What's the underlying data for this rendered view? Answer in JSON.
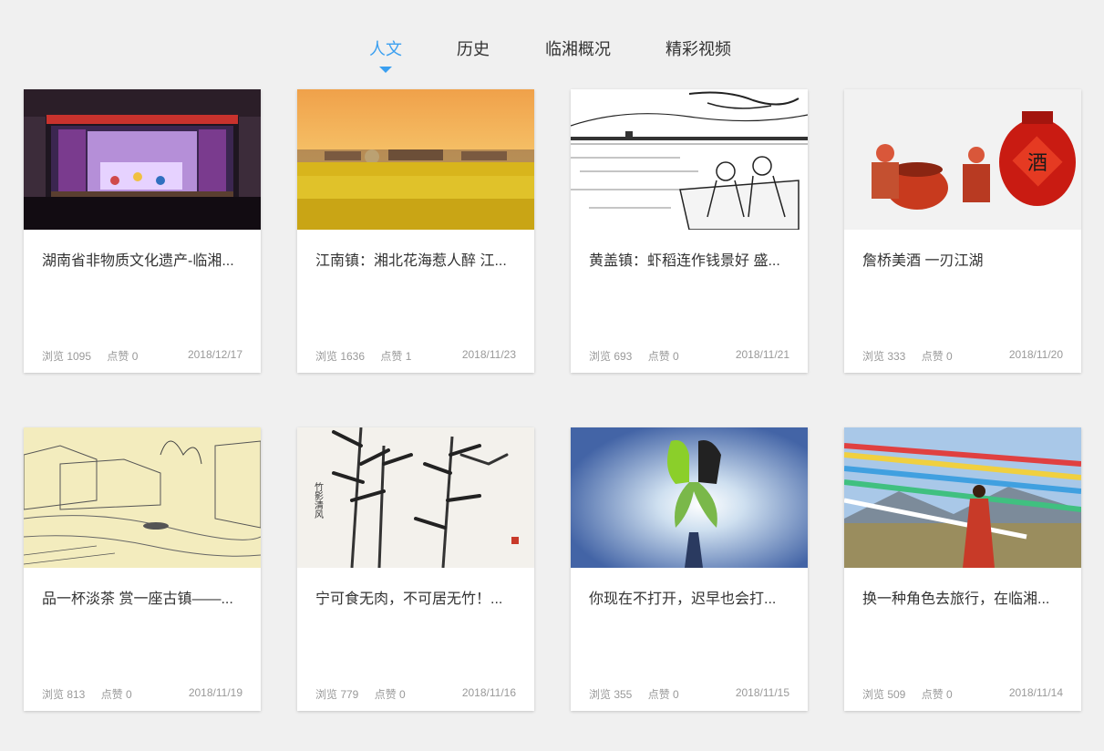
{
  "tabs": [
    {
      "label": "人文",
      "active": true
    },
    {
      "label": "历史",
      "active": false
    },
    {
      "label": "临湘概况",
      "active": false
    },
    {
      "label": "精彩视频",
      "active": false
    }
  ],
  "accent_color": "#3a9ff0",
  "cards": [
    {
      "title": "湖南省非物质文化遗产-临湘...",
      "views": "浏览 1095",
      "likes": "点赞 0",
      "date": "2018/12/17",
      "image": "stage-performance-photo"
    },
    {
      "title": "江南镇：湘北花海惹人醉 江...",
      "views": "浏览 1636",
      "likes": "点赞 1",
      "date": "2018/11/23",
      "image": "rapeseed-field-sunset-photo"
    },
    {
      "title": "黄盖镇：虾稻连作钱景好 盛...",
      "views": "浏览 693",
      "likes": "点赞 0",
      "date": "2018/11/21",
      "image": "ink-boat-illustration"
    },
    {
      "title": "詹桥美酒 一刃江湖",
      "views": "浏览 333",
      "likes": "点赞 0",
      "date": "2018/11/20",
      "image": "wine-jar-illustration"
    },
    {
      "title": "品一杯淡茶 赏一座古镇——...",
      "views": "浏览 813",
      "likes": "点赞 0",
      "date": "2018/11/19",
      "image": "old-town-sketch"
    },
    {
      "title": "宁可食无肉，不可居无竹！...",
      "views": "浏览 779",
      "likes": "点赞 0",
      "date": "2018/11/16",
      "image": "bamboo-ink-painting"
    },
    {
      "title": "你现在不打开，迟早也会打...",
      "views": "浏览 355",
      "likes": "点赞 0",
      "date": "2018/11/15",
      "image": "leaf-silhouette-photo"
    },
    {
      "title": "换一种角色去旅行，在临湘...",
      "views": "浏览 509",
      "likes": "点赞 0",
      "date": "2018/11/14",
      "image": "prayer-flags-photo"
    }
  ]
}
